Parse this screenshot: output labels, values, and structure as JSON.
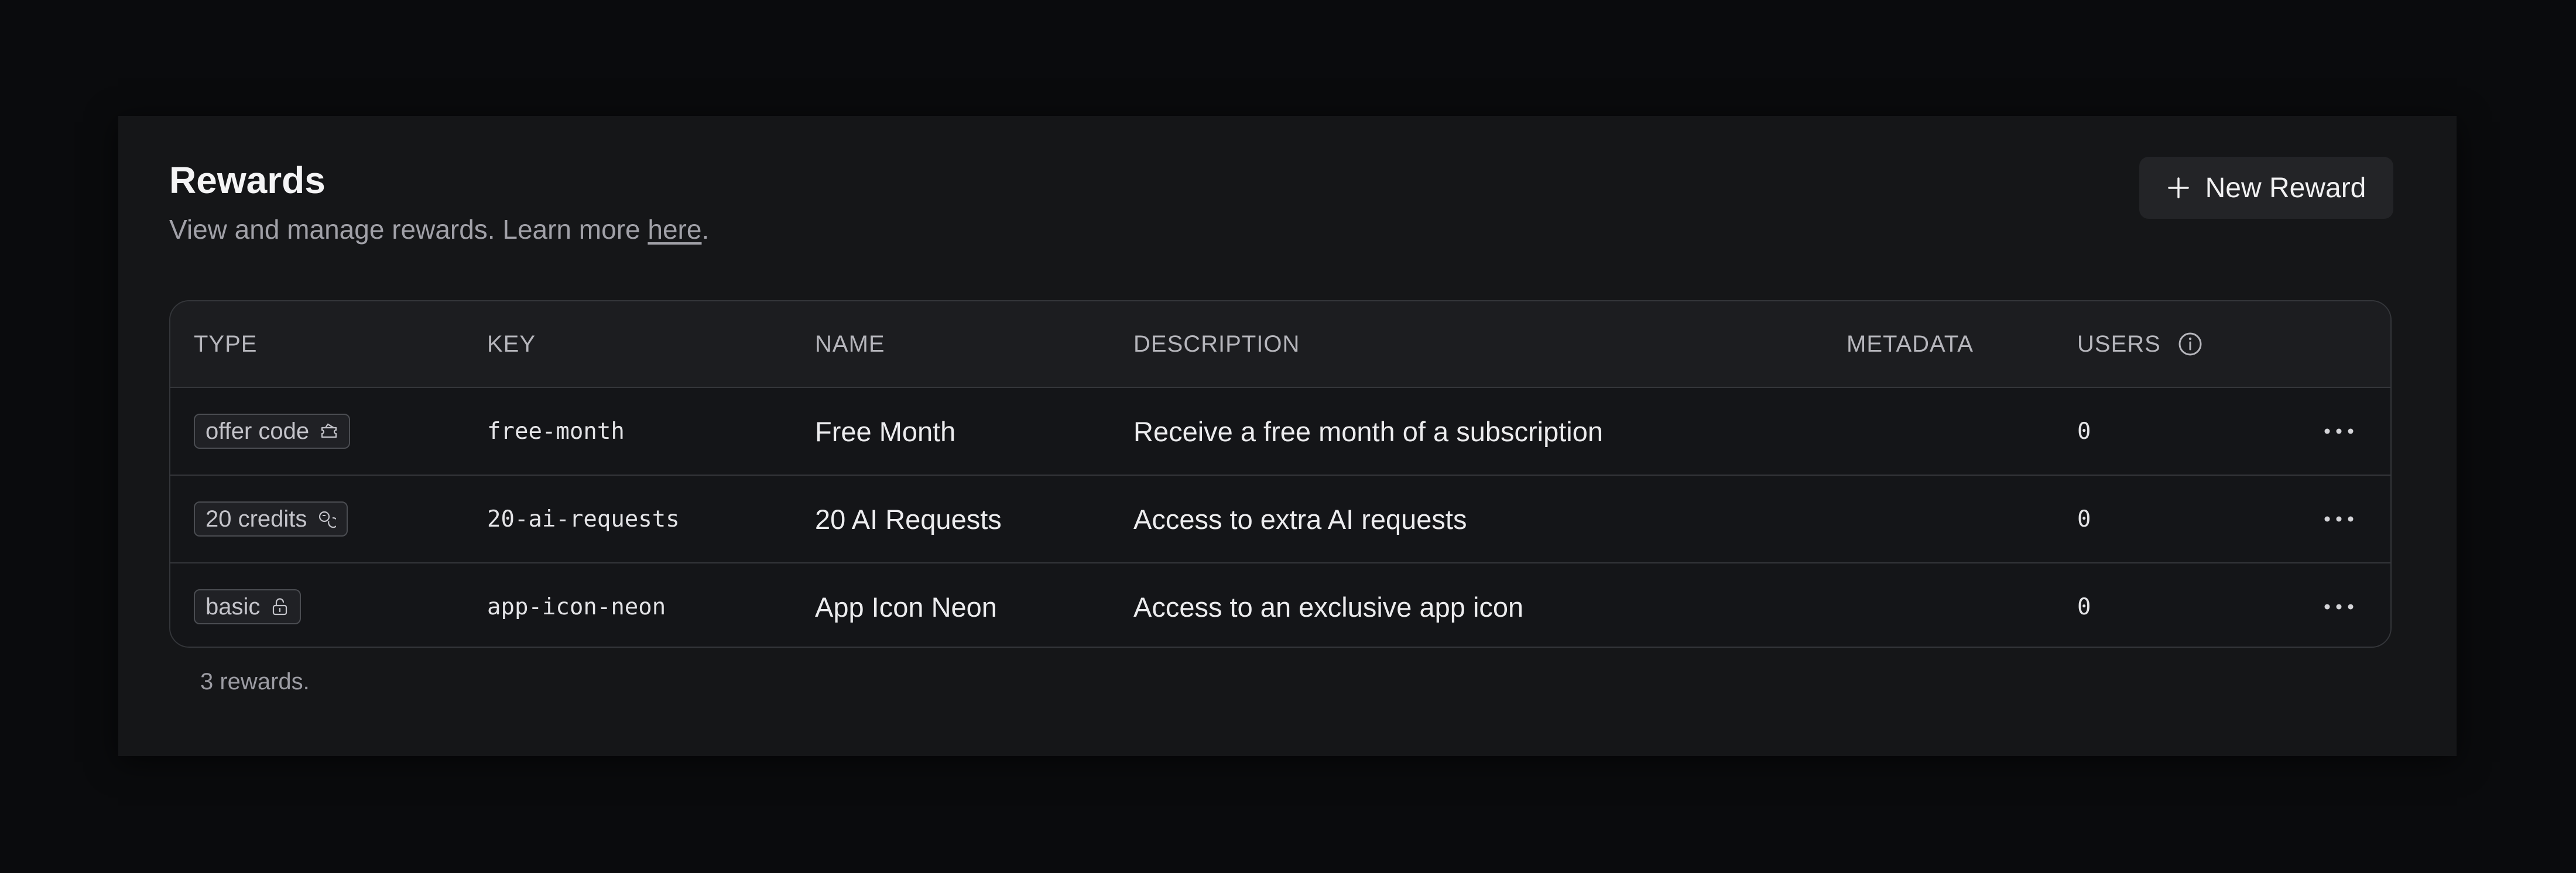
{
  "header": {
    "title": "Rewards",
    "subtitle_prefix": "View and manage rewards. Learn more ",
    "subtitle_link": "here",
    "subtitle_suffix": "."
  },
  "actions": {
    "new_reward_label": "New Reward",
    "new_reward_icon": "plus-icon"
  },
  "table": {
    "columns": [
      "TYPE",
      "KEY",
      "NAME",
      "DESCRIPTION",
      "METADATA",
      "USERS"
    ],
    "users_info_icon": "info-icon",
    "rows": [
      {
        "type": "offer code",
        "type_icon": "ticket-icon",
        "key": "free-month",
        "name": "Free Month",
        "description": "Receive a free month of a subscription",
        "metadata": "",
        "users": "0"
      },
      {
        "type": "20 credits",
        "type_icon": "coins-icon",
        "key": "20-ai-requests",
        "name": "20 AI Requests",
        "description": "Access to extra AI requests",
        "metadata": "",
        "users": "0"
      },
      {
        "type": "basic",
        "type_icon": "unlock-icon",
        "key": "app-icon-neon",
        "name": "App Icon Neon",
        "description": "Access to an exclusive app icon",
        "metadata": "",
        "users": "0"
      }
    ]
  },
  "footer": {
    "count_text": "3 rewards."
  },
  "colors": {
    "background": "#0a0b0d",
    "panel": "#151618",
    "table_header": "#1c1d20",
    "border": "#34363a",
    "button": "#232427"
  }
}
